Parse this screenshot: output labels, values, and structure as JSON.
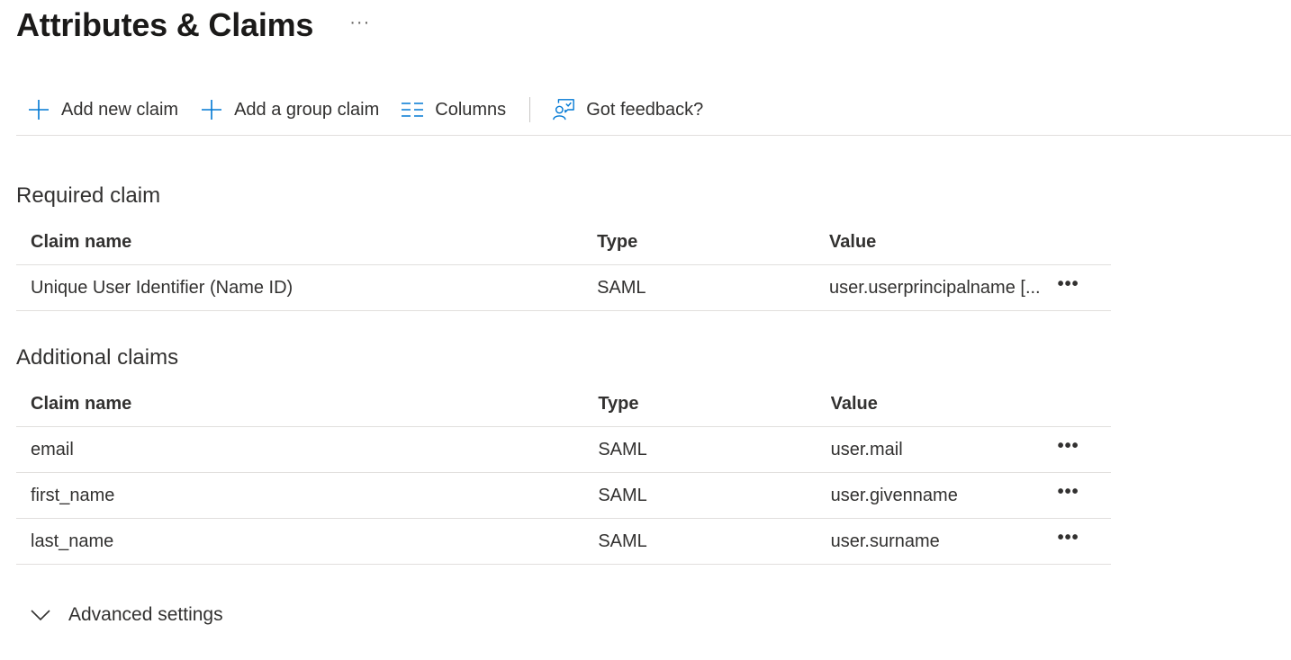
{
  "header": {
    "title": "Attributes & Claims",
    "more": "···"
  },
  "toolbar": {
    "add_new_claim": "Add new claim",
    "add_group_claim": "Add a group claim",
    "columns": "Columns",
    "feedback": "Got feedback?"
  },
  "required": {
    "title": "Required claim",
    "columns": [
      "Claim name",
      "Type",
      "Value"
    ],
    "rows": [
      {
        "name": "Unique User Identifier (Name ID)",
        "type": "SAML",
        "value": "user.userprincipalname [..."
      }
    ]
  },
  "additional": {
    "title": "Additional claims",
    "columns": [
      "Claim name",
      "Type",
      "Value"
    ],
    "rows": [
      {
        "name": "email",
        "type": "SAML",
        "value": "user.mail"
      },
      {
        "name": "first_name",
        "type": "SAML",
        "value": "user.givenname"
      },
      {
        "name": "last_name",
        "type": "SAML",
        "value": "user.surname"
      }
    ]
  },
  "row_more": "•••",
  "advanced": {
    "label": "Advanced settings"
  },
  "colors": {
    "accent": "#0078d4",
    "text": "#323130",
    "divider": "#e1dfdd"
  }
}
